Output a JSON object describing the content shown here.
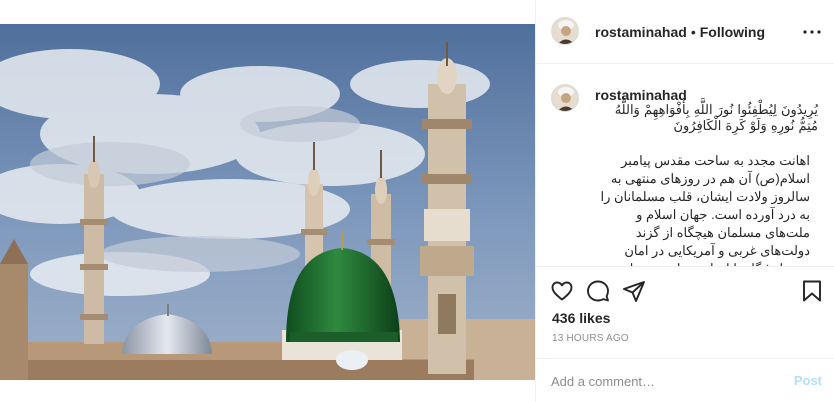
{
  "colors": {
    "text": "#262626",
    "muted": "#8e8e8e",
    "post_button": "#b2dffc",
    "divider": "#efefef"
  },
  "post": {
    "image_alt": "",
    "header": {
      "username": "rostaminahad",
      "separator": "•",
      "follow_status": "Following",
      "more_icon": "more-horizontal-icon"
    },
    "caption": {
      "username": "rostaminahad",
      "verse": "يُرِيدُونَ لِيُطْفِئُوا نُورَ اللَّهِ بِأَفْوَاهِهِمْ وَاللَّهُ مُتِمُّ نُورِهِ وَلَوْ كَرِهَ الْكَافِرُونَ",
      "body": "اهانت مجدد به ساحت مقدس پیامبر اسلام(ص) آن هم در روزهای منتهی به سالروز ولادت ایشان، قلب مسلمانان را به درد آورده است. جهان اسلام و ملت‌های مسلمان هیچگاه از گزند دولت‌های غربی و آمریکایی در امان نبوده‌اند؛ گاه با ایجاد، حمایت و هدایت"
    },
    "actions": {
      "like_icon": "heart-icon",
      "comment_icon": "comment-icon",
      "share_icon": "share-icon",
      "save_icon": "bookmark-icon"
    },
    "likes": "436 likes",
    "timestamp": "13 HOURS AGO",
    "comment": {
      "placeholder": "Add a comment…",
      "post_label": "Post"
    }
  }
}
